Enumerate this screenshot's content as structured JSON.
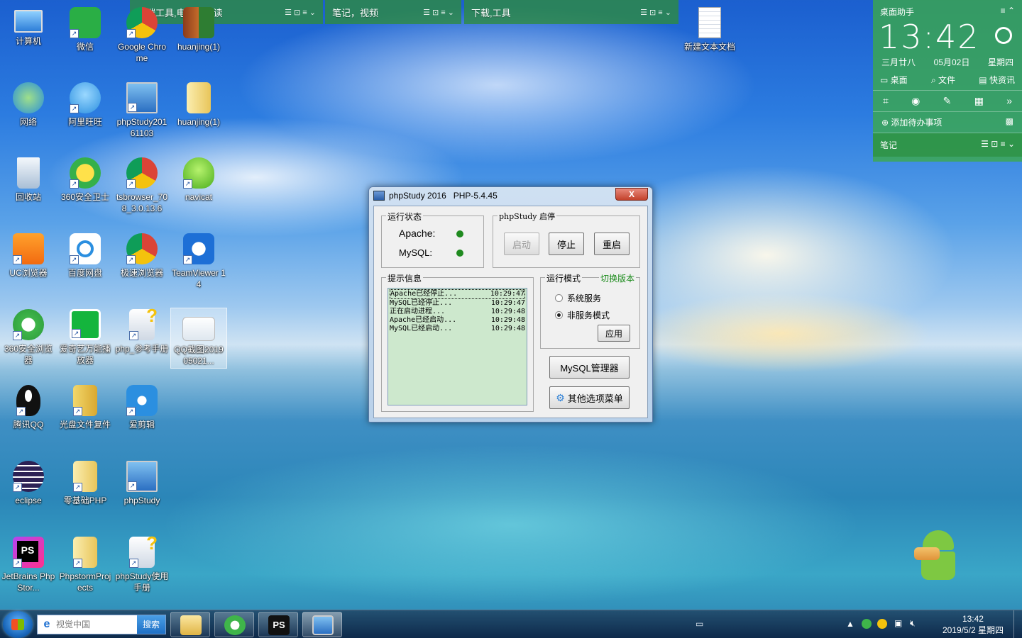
{
  "colors": {
    "fence_green": "#2e8c3c",
    "status_ok": "#1f8a1f",
    "log_bg": "#cde8cd",
    "switch_version": "#1a8a1a"
  },
  "fences": [
    {
      "title": "前端工具,电子书阅读"
    },
    {
      "title": "笔记，视频"
    },
    {
      "title": "下载,工具"
    }
  ],
  "desktop_icons": [
    {
      "label": "计算机",
      "icon": "computer-icon"
    },
    {
      "label": "微信",
      "icon": "wechat-icon"
    },
    {
      "label": "Google Chrome",
      "icon": "chrome-icon"
    },
    {
      "label": "huanjing(1)",
      "icon": "archive-icon"
    },
    {
      "label": "网络",
      "icon": "network-icon"
    },
    {
      "label": "阿里旺旺",
      "icon": "aliwangwang-icon"
    },
    {
      "label": "phpStudy20161103",
      "icon": "phpstudy-icon"
    },
    {
      "label": "huanjing(1)",
      "icon": "folder-icon"
    },
    {
      "label": "回收站",
      "icon": "recycle-bin-icon"
    },
    {
      "label": "360安全卫士",
      "icon": "360-security-icon"
    },
    {
      "label": "tsbrowser_708_3.0.13.6",
      "icon": "chrome-icon"
    },
    {
      "label": "navicat",
      "icon": "navicat-icon"
    },
    {
      "label": "UC浏览器",
      "icon": "uc-browser-icon"
    },
    {
      "label": "百度网盘",
      "icon": "baidu-netdisk-icon"
    },
    {
      "label": "极速浏览器",
      "icon": "chrome-icon"
    },
    {
      "label": "TeamViewer 14",
      "icon": "teamviewer-icon"
    },
    {
      "label": "360安全浏览器",
      "icon": "360-browser-icon"
    },
    {
      "label": "爱奇艺万能播放器",
      "icon": "iqiyi-player-icon"
    },
    {
      "label": "php_参考手册",
      "icon": "help-file-icon"
    },
    {
      "label": "QQ截图201905021...",
      "icon": "screenshot-file-icon"
    },
    {
      "label": "腾讯QQ",
      "icon": "qq-icon"
    },
    {
      "label": "光盘文件复件",
      "icon": "disc-folder-icon"
    },
    {
      "label": "爱剪辑",
      "icon": "aijianji-icon"
    },
    {
      "label": "eclipse",
      "icon": "eclipse-icon"
    },
    {
      "label": "零基础PHP",
      "icon": "folder-icon"
    },
    {
      "label": "phpStudy",
      "icon": "phpstudy-icon"
    },
    {
      "label": "JetBrains PhpStor...",
      "icon": "phpstorm-icon"
    },
    {
      "label": "PhpstormProjects",
      "icon": "folder-icon"
    },
    {
      "label": "phpStudy使用手册",
      "icon": "help-file-icon"
    },
    {
      "label": "新建文本文档",
      "icon": "text-file-icon"
    }
  ],
  "assistant": {
    "title": "桌面助手",
    "time": "13:42",
    "lunar": "三月廿八",
    "date": "05月02日",
    "weekday": "星期四",
    "tabs": [
      "桌面",
      "文件",
      "快资讯"
    ],
    "add_todo": "添加待办事项",
    "notes": "笔记"
  },
  "phpstudy": {
    "title": "phpStudy 2016   PHP-5.4.45",
    "close_label": "X",
    "status_group": "运行状态",
    "apache_label": "Apache:",
    "mysql_label": "MySQL:",
    "control_group": "phpStudy 启停",
    "start": "启动",
    "stop": "停止",
    "restart": "重启",
    "info_group": "提示信息",
    "log": [
      {
        "msg": "Apache已经停止...",
        "time": "10:29:47"
      },
      {
        "msg": "MySQL已经停止...",
        "time": "10:29:47"
      },
      {
        "msg": "正在启动进程...",
        "time": "10:29:48"
      },
      {
        "msg": "Apache已经启动...",
        "time": "10:29:48"
      },
      {
        "msg": "MySQL已经启动...",
        "time": "10:29:48"
      }
    ],
    "mode_group": "运行模式",
    "switch_version": "切换版本",
    "mode_service": "系统服务",
    "mode_nonservice": "非服务模式",
    "apply": "应用",
    "mysql_manager": "MySQL管理器",
    "other_menu": "其他选项菜单"
  },
  "taskbar": {
    "search_placeholder": "视觉中国",
    "search_button": "搜索",
    "clock_time": "13:42",
    "clock_date": "2019/5/2 星期四"
  }
}
